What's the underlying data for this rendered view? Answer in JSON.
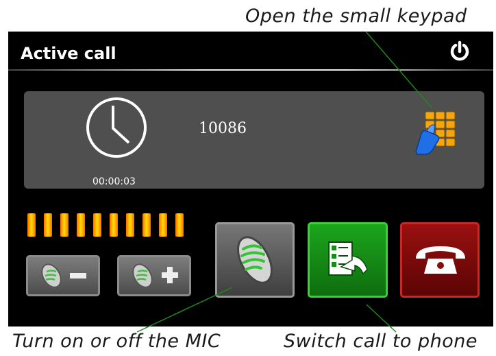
{
  "annotations": {
    "keypad": "Open the small keypad",
    "mic": "Turn on or off the MIC",
    "phone": "Switch call to phone"
  },
  "header": {
    "title": "Active call"
  },
  "call": {
    "number": "10086",
    "duration": "00:00:03"
  },
  "volume": {
    "bars": 10,
    "filled": 10
  },
  "icons": {
    "power": "power-icon",
    "clock": "clock-icon",
    "keypad": "keypad-icon",
    "vol_down": "mic-minus-icon",
    "vol_up": "mic-plus-icon",
    "mic": "microphone-icon",
    "switch": "switch-to-phone-icon",
    "hangup": "hang-up-icon"
  },
  "colors": {
    "screen": "#000000",
    "panel": "#4f4f4f",
    "switch": "#1a9a1a",
    "hangup": "#8a0c0c",
    "volume_bar": "#ffb300",
    "annotation_line": "#1d8a1d"
  }
}
